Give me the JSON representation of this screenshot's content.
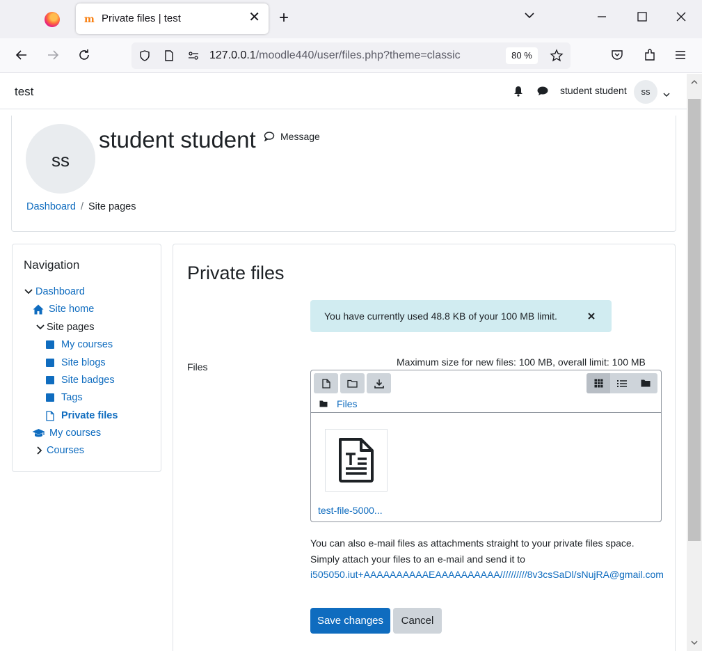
{
  "browser": {
    "tab_title": "Private files | test",
    "url_host": "127.0.0.1",
    "url_path": "/moodle440/user/files.php?theme=classic",
    "zoom": "80 %"
  },
  "site": {
    "name": "test",
    "user_name": "student student",
    "user_initials": "ss"
  },
  "profile": {
    "initials": "ss",
    "full_name": "student student",
    "message_label": "Message"
  },
  "breadcrumb": {
    "items": [
      "Dashboard",
      "Site pages"
    ]
  },
  "navigation": {
    "title": "Navigation",
    "dashboard": "Dashboard",
    "site_home": "Site home",
    "site_pages": "Site pages",
    "my_courses_page": "My courses",
    "site_blogs": "Site blogs",
    "site_badges": "Site badges",
    "tags": "Tags",
    "private_files": "Private files",
    "my_courses": "My courses",
    "courses": "Courses"
  },
  "main": {
    "title": "Private files",
    "alert": "You have currently used 48.8 KB of your 100 MB limit.",
    "files_label": "Files",
    "max_size": "Maximum size for new files: 100 MB, overall limit: 100 MB",
    "path_label": "Files",
    "file_name": "test-file-5000...",
    "email_text": "You can also e-mail files as attachments straight to your private files space. Simply attach your files to an e-mail and send it to",
    "email_address": "i505050.iut+AAAAAAAAAAEAAAAAAAAAA//////////8v3csSaDl/sNujRA@gmail.com",
    "save_label": "Save changes",
    "cancel_label": "Cancel"
  },
  "colors": {
    "link": "#0f6cbf",
    "alert_bg": "#d1ecf1",
    "primary_button": "#0f6cbf"
  }
}
